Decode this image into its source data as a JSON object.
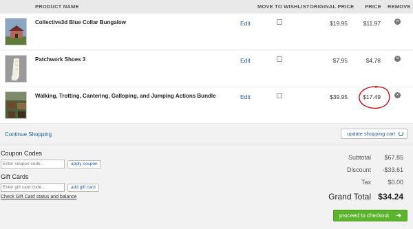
{
  "columns": {
    "product_name": "PRODUCT NAME",
    "move_to_wishlist": "MOVE TO WISHLIST",
    "original_price": "ORIGINAL PRICE",
    "price": "PRICE",
    "remove": "REMOVE"
  },
  "items": [
    {
      "name": "Collective3d Blue Collar Bungalow",
      "edit": "Edit",
      "original_price": "$19.95",
      "price": "$11.97",
      "remove": "×"
    },
    {
      "name": "Patchwork Shoes 3",
      "edit": "Edit",
      "original_price": "$7.95",
      "price": "$4.78",
      "remove": "×"
    },
    {
      "name": "Walking, Trotting, Cantering, Galloping, and Jumping Actions Bundle",
      "edit": "Edit",
      "original_price": "$39.95",
      "price": "$17.49",
      "remove": "×"
    }
  ],
  "continue_shopping": "Continue Shopping",
  "update_cart": "update shopping cart",
  "coupon": {
    "title": "Coupon Codes",
    "placeholder": "Enter coupon code...",
    "button": "apply coupon"
  },
  "gift": {
    "title": "Gift Cards",
    "placeholder": "Enter gift card code...",
    "button": "add gift card",
    "link": "Check Gift Card status and balance"
  },
  "summary": {
    "subtotal_label": "Subtotal",
    "subtotal": "$67.85",
    "discount_label": "Discount",
    "discount": "-$33.61",
    "tax_label": "Tax",
    "tax": "$0.00",
    "grand_total_label": "Grand Total",
    "grand_total": "$34.24"
  },
  "checkout_label": "proceed to checkout",
  "checkout_icon": "arrow-right-icon",
  "colors": {
    "link": "#1f5fa8",
    "checkout": "#5bb42c",
    "annotation": "#d0101a"
  }
}
